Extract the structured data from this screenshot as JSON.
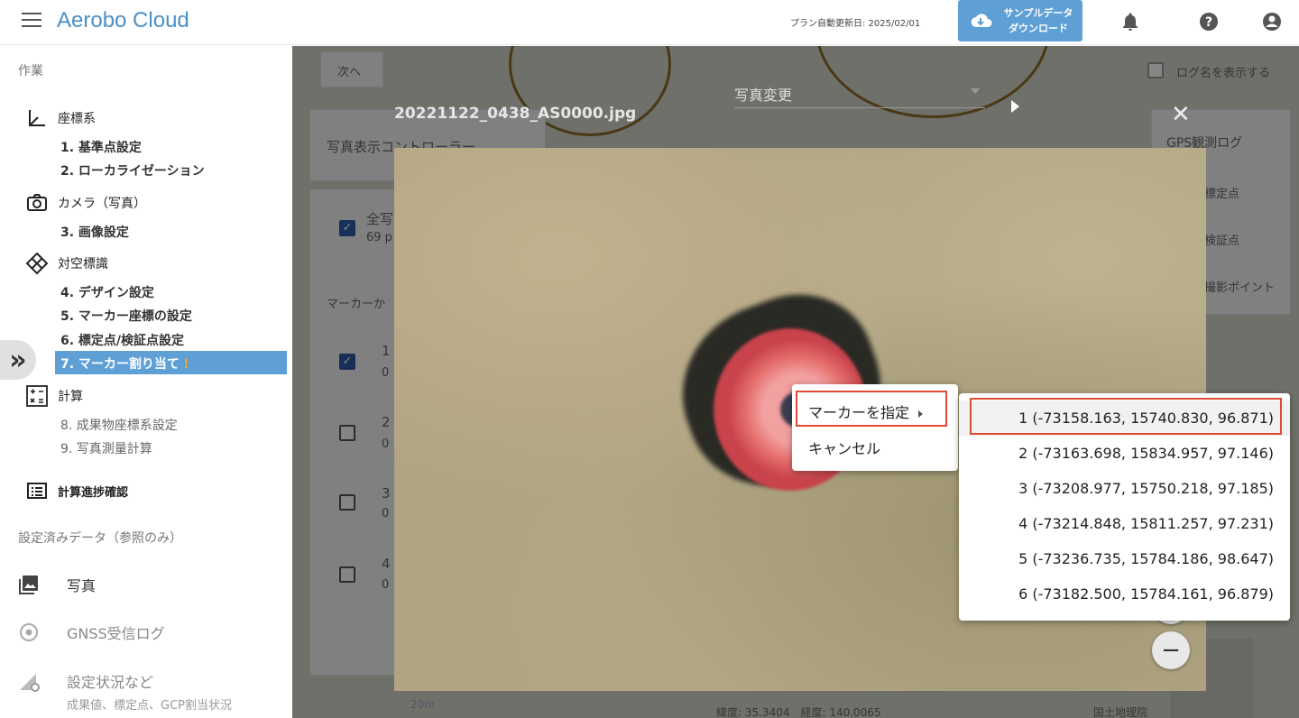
{
  "header": {
    "brand": "Aerobo Cloud",
    "plan_date": "プラン自動更新日: 2025/02/01",
    "download_line1": "サンプルデータ",
    "download_line2": "ダウンロード"
  },
  "sidebar": {
    "section_work": "作業",
    "coord_system": "座標系",
    "step1": "1. 基準点設定",
    "step2": "2. ローカライゼーション",
    "camera": "カメラ（写真）",
    "step3": "3. 画像設定",
    "markers": "対空標識",
    "step4": "4. デザイン設定",
    "step5": "5. マーカー座標の設定",
    "step6": "6. 標定点/検証点設定",
    "step7": "7. マーカー割り当て",
    "step7_warn": "!",
    "calc": "計算",
    "step8": "8. 成果物座標系設定",
    "step9": "9. 写真測量計算",
    "progress": "計算進捗確認",
    "section_ref": "設定済みデータ（参照のみ）",
    "photos": "写真",
    "gnss": "GNSS受信ログ",
    "status": "設定状況など",
    "status_sub": "成果値、標定点、GCP割当状況"
  },
  "background": {
    "next_button": "次へ",
    "show_log_names": "ログ名を表示する",
    "photo_controller": "写真表示コントローラー",
    "all_photos": "全写",
    "photo_count": "69 p",
    "marker_label": "マーカーか",
    "gps_log": "GPS観測ログ",
    "control_point": "標定点",
    "check_point": "検証点",
    "shot_point": "撮影ポイント",
    "rows": [
      {
        "num": "1",
        "sub": "0"
      },
      {
        "num": "2",
        "sub": "0"
      },
      {
        "num": "3",
        "sub": "0"
      },
      {
        "num": "4",
        "sub": "0"
      }
    ],
    "scale": "20m",
    "lat_lon": "緯度: 35.3404　経度: 140.0065",
    "gsi": "国土地理院"
  },
  "viewer": {
    "filename": "20221122_0438_AS0000.jpg",
    "photo_change": "写真変更",
    "zoom_in": "+",
    "zoom_out": "−"
  },
  "context_menu": {
    "assign_marker": "マーカーを指定",
    "cancel": "キャンセル"
  },
  "marker_list": [
    {
      "label": "1 (-73158.163, 15740.830, 96.871)"
    },
    {
      "label": "2 (-73163.698, 15834.957, 97.146)"
    },
    {
      "label": "3 (-73208.977, 15750.218, 97.185)"
    },
    {
      "label": "4 (-73214.848, 15811.257, 97.231)"
    },
    {
      "label": "5 (-73236.735, 15784.186, 98.647)"
    },
    {
      "label": "6 (-73182.500, 15784.161, 96.879)"
    }
  ],
  "colors": {
    "accent": "#5e9fd6",
    "highlight": "#e04b35",
    "warning": "#f5a623"
  }
}
